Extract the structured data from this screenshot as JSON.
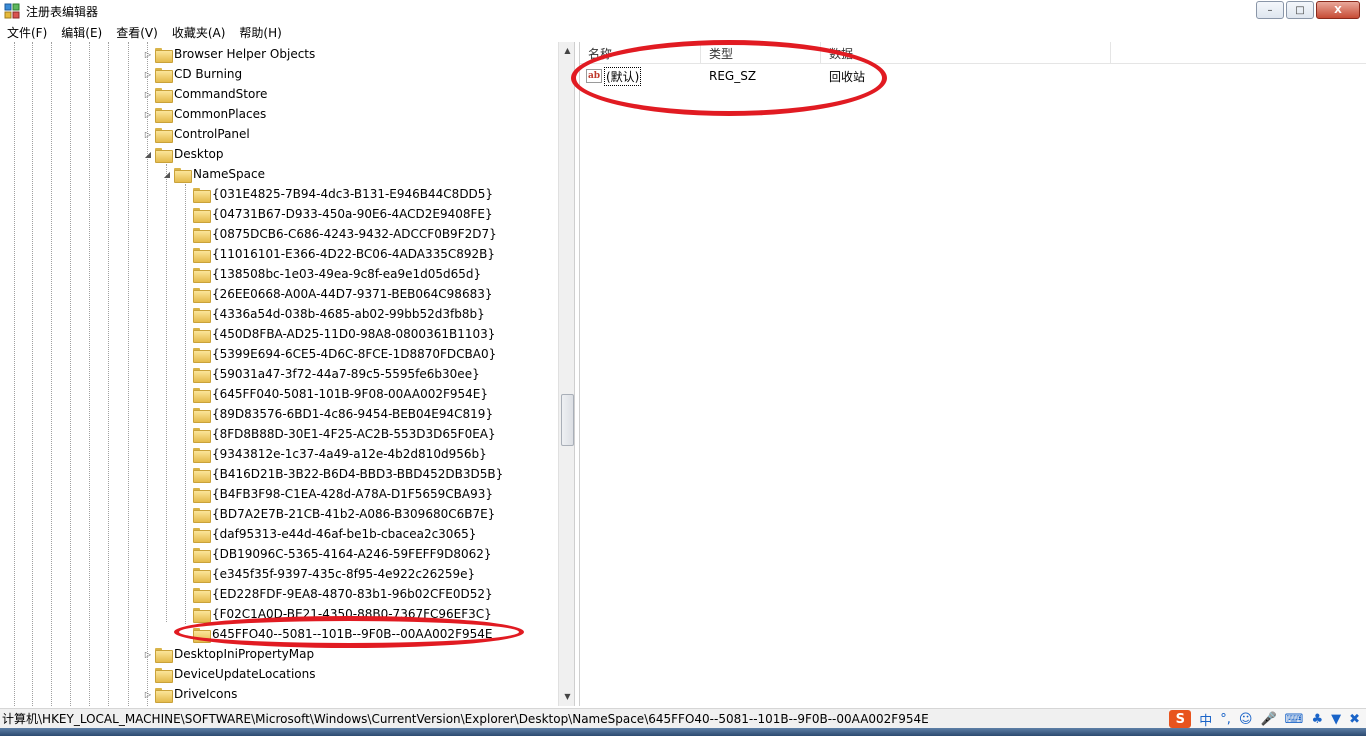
{
  "window": {
    "title": "注册表编辑器",
    "minimize": "–",
    "maximize": "□",
    "close": "X"
  },
  "menu": [
    "文件(F)",
    "编辑(E)",
    "查看(V)",
    "收藏夹(A)",
    "帮助(H)"
  ],
  "tree": {
    "items": [
      {
        "label": "Browser Helper Objects",
        "level": 1,
        "expander": "▷"
      },
      {
        "label": "CD Burning",
        "level": 1,
        "expander": "▷"
      },
      {
        "label": "CommandStore",
        "level": 1,
        "expander": "▷"
      },
      {
        "label": "CommonPlaces",
        "level": 1,
        "expander": "▷"
      },
      {
        "label": "ControlPanel",
        "level": 1,
        "expander": "▷"
      },
      {
        "label": "Desktop",
        "level": 1,
        "expander": "◢"
      },
      {
        "label": "NameSpace",
        "level": 2,
        "expander": "◢"
      },
      {
        "label": "{031E4825-7B94-4dc3-B131-E946B44C8DD5}",
        "level": 3,
        "expander": ""
      },
      {
        "label": "{04731B67-D933-450a-90E6-4ACD2E9408FE}",
        "level": 3,
        "expander": ""
      },
      {
        "label": "{0875DCB6-C686-4243-9432-ADCCF0B9F2D7}",
        "level": 3,
        "expander": ""
      },
      {
        "label": "{11016101-E366-4D22-BC06-4ADA335C892B}",
        "level": 3,
        "expander": ""
      },
      {
        "label": "{138508bc-1e03-49ea-9c8f-ea9e1d05d65d}",
        "level": 3,
        "expander": ""
      },
      {
        "label": "{26EE0668-A00A-44D7-9371-BEB064C98683}",
        "level": 3,
        "expander": ""
      },
      {
        "label": "{4336a54d-038b-4685-ab02-99bb52d3fb8b}",
        "level": 3,
        "expander": ""
      },
      {
        "label": "{450D8FBA-AD25-11D0-98A8-0800361B1103}",
        "level": 3,
        "expander": ""
      },
      {
        "label": "{5399E694-6CE5-4D6C-8FCE-1D8870FDCBA0}",
        "level": 3,
        "expander": ""
      },
      {
        "label": "{59031a47-3f72-44a7-89c5-5595fe6b30ee}",
        "level": 3,
        "expander": ""
      },
      {
        "label": "{645FF040-5081-101B-9F08-00AA002F954E}",
        "level": 3,
        "expander": ""
      },
      {
        "label": "{89D83576-6BD1-4c86-9454-BEB04E94C819}",
        "level": 3,
        "expander": ""
      },
      {
        "label": "{8FD8B88D-30E1-4F25-AC2B-553D3D65F0EA}",
        "level": 3,
        "expander": ""
      },
      {
        "label": "{9343812e-1c37-4a49-a12e-4b2d810d956b}",
        "level": 3,
        "expander": ""
      },
      {
        "label": "{B416D21B-3B22-B6D4-BBD3-BBD452DB3D5B}",
        "level": 3,
        "expander": ""
      },
      {
        "label": "{B4FB3F98-C1EA-428d-A78A-D1F5659CBA93}",
        "level": 3,
        "expander": ""
      },
      {
        "label": "{BD7A2E7B-21CB-41b2-A086-B309680C6B7E}",
        "level": 3,
        "expander": ""
      },
      {
        "label": "{daf95313-e44d-46af-be1b-cbacea2c3065}",
        "level": 3,
        "expander": ""
      },
      {
        "label": "{DB19096C-5365-4164-A246-59FEFF9D8062}",
        "level": 3,
        "expander": ""
      },
      {
        "label": "{e345f35f-9397-435c-8f95-4e922c26259e}",
        "level": 3,
        "expander": ""
      },
      {
        "label": "{ED228FDF-9EA8-4870-83b1-96b02CFE0D52}",
        "level": 3,
        "expander": ""
      },
      {
        "label": "{F02C1A0D-BE21-4350-88B0-7367FC96EF3C}",
        "level": 3,
        "expander": ""
      },
      {
        "label": "645FFO40--5081--101B--9F0B--00AA002F954E",
        "level": 3,
        "expander": ""
      },
      {
        "label": "DesktopIniPropertyMap",
        "level": 1,
        "expander": "▷"
      },
      {
        "label": "DeviceUpdateLocations",
        "level": 1,
        "expander": ""
      },
      {
        "label": "DriveIcons",
        "level": 1,
        "expander": "▷"
      }
    ]
  },
  "list": {
    "headers": {
      "name": "名称",
      "type": "类型",
      "data": "数据"
    },
    "rows": [
      {
        "icon": "ab",
        "name": "(默认)",
        "type": "REG_SZ",
        "data": "回收站"
      }
    ]
  },
  "status": {
    "path": "计算机\\HKEY_LOCAL_MACHINE\\SOFTWARE\\Microsoft\\Windows\\CurrentVersion\\Explorer\\Desktop\\NameSpace\\645FFO40--5081--101B--9F0B--00AA002F954E"
  },
  "ime": {
    "logo": "S",
    "mode": "中",
    "punct": "°,",
    "icons": [
      "emoji-icon",
      "mic-icon",
      "keyboard-icon",
      "skin-icon",
      "shirt-icon",
      "tools-icon"
    ]
  },
  "colors": {
    "annotation": "#e11b22",
    "folder": "#e4bb4c"
  }
}
